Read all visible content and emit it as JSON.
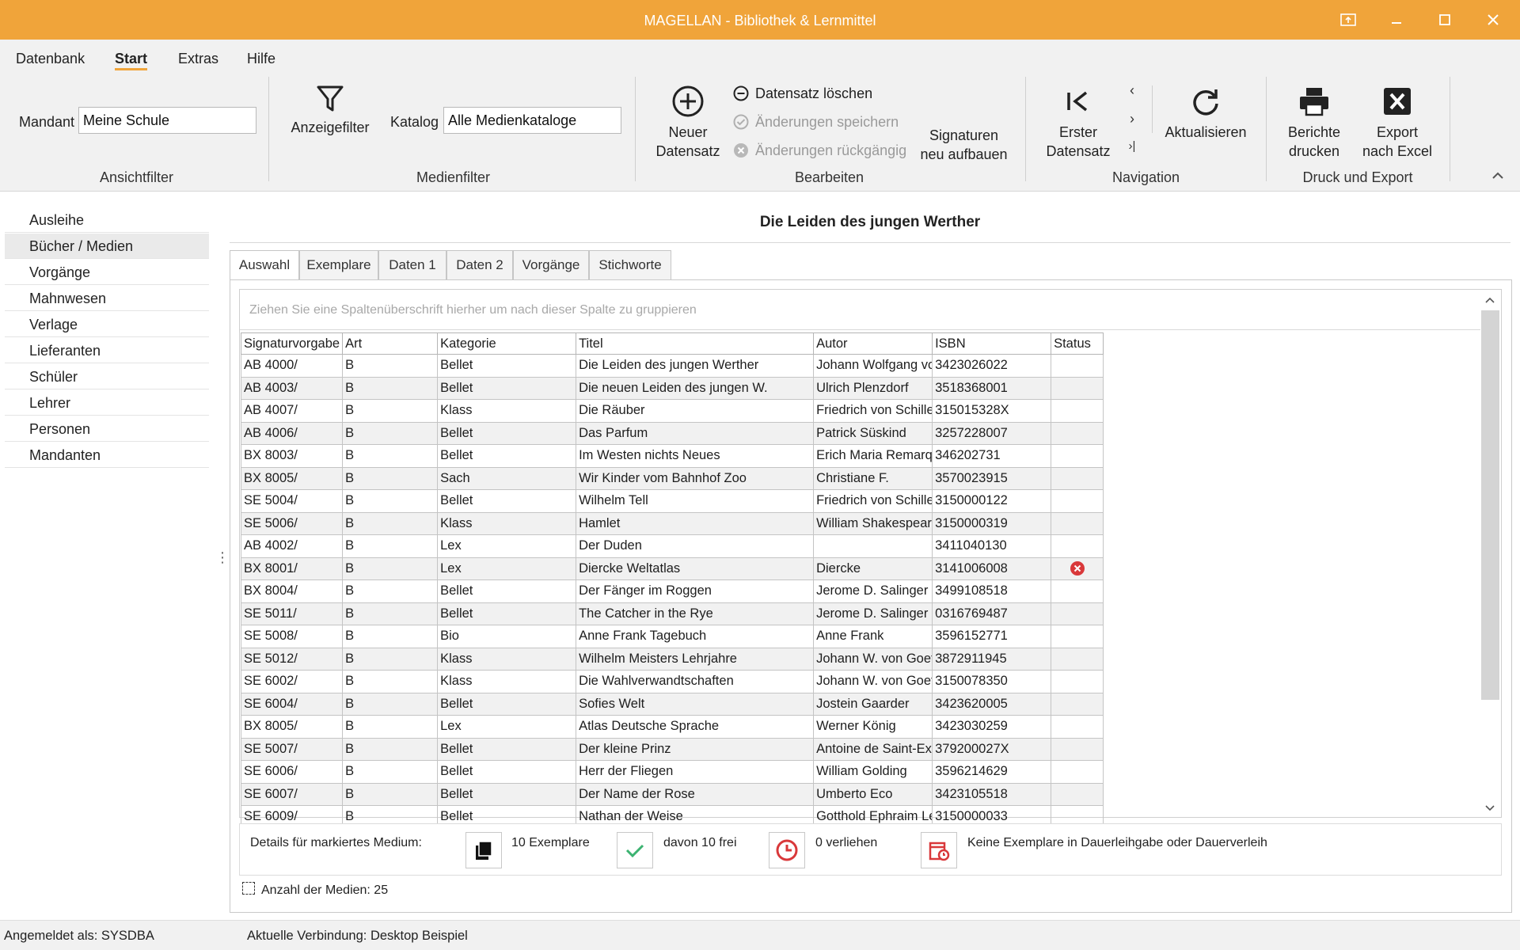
{
  "window": {
    "title": "MAGELLAN - Bibliothek & Lernmittel"
  },
  "menu": {
    "items": [
      "Datenbank",
      "Start",
      "Extras",
      "Hilfe"
    ],
    "active": "Start"
  },
  "ribbon": {
    "ansichtfilter": {
      "mandant_label": "Mandant",
      "mandant_value": "Meine Schule",
      "group": "Ansichtfilter"
    },
    "medienfilter": {
      "anzeigefilter": "Anzeigefilter",
      "katalog_label": "Katalog",
      "katalog_value": "Alle Medienkataloge",
      "group": "Medienfilter"
    },
    "bearbeiten": {
      "neuer_line1": "Neuer",
      "neuer_line2": "Datensatz",
      "loeschen": "Datensatz löschen",
      "speichern": "Änderungen speichern",
      "rueckgaengig": "Änderungen rückgängig",
      "signaturen_line1": "Signaturen",
      "signaturen_line2": "neu aufbauen",
      "group": "Bearbeiten"
    },
    "navigation": {
      "erster_line1": "Erster",
      "erster_line2": "Datensatz",
      "aktualisieren": "Aktualisieren",
      "group": "Navigation"
    },
    "druck": {
      "berichte_line1": "Berichte",
      "berichte_line2": "drucken",
      "export_line1": "Export",
      "export_line2": "nach Excel",
      "group": "Druck und Export"
    }
  },
  "sidebar": {
    "items": [
      {
        "label": "Ausleihe"
      },
      {
        "label": "Bücher / Medien"
      },
      {
        "label": "Vorgänge"
      },
      {
        "label": "Mahnwesen"
      },
      {
        "label": "Verlage"
      },
      {
        "label": "Lieferanten"
      },
      {
        "label": "Schüler"
      },
      {
        "label": "Lehrer"
      },
      {
        "label": "Personen"
      },
      {
        "label": "Mandanten"
      }
    ],
    "selected": "Bücher / Medien"
  },
  "main": {
    "heading": "Die Leiden des jungen Werther",
    "tabs": [
      "Auswahl",
      "Exemplare",
      "Daten 1",
      "Daten 2",
      "Vorgänge",
      "Stichworte"
    ],
    "active_tab": "Auswahl",
    "group_hint": "Ziehen Sie eine Spaltenüberschrift hierher um nach dieser Spalte zu gruppieren",
    "columns": [
      "Signaturvorgabe",
      "Art",
      "Kategorie",
      "Titel",
      "Autor",
      "ISBN",
      "Status"
    ],
    "rows": [
      [
        "AB 4000/",
        "B",
        "Bellet",
        "Die Leiden des jungen Werther",
        "Johann Wolfgang von Goethe",
        "3423026022",
        ""
      ],
      [
        "AB 4003/",
        "B",
        "Bellet",
        "Die neuen Leiden des jungen W.",
        "Ulrich Plenzdorf",
        "3518368001",
        ""
      ],
      [
        "AB 4007/",
        "B",
        "Klass",
        "Die Räuber",
        "Friedrich von Schiller",
        "315015328X",
        ""
      ],
      [
        "AB 4006/",
        "B",
        "Bellet",
        "Das Parfum",
        "Patrick Süskind",
        "3257228007",
        ""
      ],
      [
        "BX 8003/",
        "B",
        "Bellet",
        "Im Westen nichts Neues",
        "Erich Maria Remarque",
        "346202731",
        ""
      ],
      [
        "BX 8005/",
        "B",
        "Sach",
        "Wir Kinder vom Bahnhof Zoo",
        "Christiane F.",
        "3570023915",
        ""
      ],
      [
        "SE 5004/",
        "B",
        "Bellet",
        "Wilhelm Tell",
        "Friedrich von Schiller",
        "3150000122",
        ""
      ],
      [
        "SE 5006/",
        "B",
        "Klass",
        "Hamlet",
        "William Shakespeare",
        "3150000319",
        ""
      ],
      [
        "AB 4002/",
        "B",
        "Lex",
        "Der Duden",
        "",
        "3411040130",
        ""
      ],
      [
        "BX 8001/",
        "B",
        "Lex",
        "Diercke Weltatlas",
        "Diercke",
        "3141006008",
        "error"
      ],
      [
        "BX 8004/",
        "B",
        "Bellet",
        "Der Fänger im Roggen",
        "Jerome D. Salinger",
        "3499108518",
        ""
      ],
      [
        "SE 5011/",
        "B",
        "Bellet",
        "The Catcher in the Rye",
        "Jerome D. Salinger",
        "0316769487",
        ""
      ],
      [
        "SE 5008/",
        "B",
        "Bio",
        "Anne Frank Tagebuch",
        "Anne Frank",
        "3596152771",
        ""
      ],
      [
        "SE 5012/",
        "B",
        "Klass",
        "Wilhelm Meisters Lehrjahre",
        "Johann W. von Goethe",
        "3872911945",
        ""
      ],
      [
        "SE 6002/",
        "B",
        "Klass",
        "Die Wahlverwandtschaften",
        "Johann W. von Goethe",
        "3150078350",
        ""
      ],
      [
        "SE 6004/",
        "B",
        "Bellet",
        "Sofies Welt",
        "Jostein Gaarder",
        "3423620005",
        ""
      ],
      [
        "BX 8005/",
        "B",
        "Lex",
        "Atlas Deutsche Sprache",
        "Werner König",
        "3423030259",
        ""
      ],
      [
        "SE 5007/",
        "B",
        "Bellet",
        "Der kleine Prinz",
        "Antoine de Saint-Exupéry",
        "379200027X",
        ""
      ],
      [
        "SE 6006/",
        "B",
        "Bellet",
        "Herr der Fliegen",
        "William Golding",
        "3596214629",
        ""
      ],
      [
        "SE 6007/",
        "B",
        "Bellet",
        "Der Name der Rose",
        "Umberto Eco",
        "3423105518",
        ""
      ],
      [
        "SE 6009/",
        "B",
        "Bellet",
        "Nathan der Weise",
        "Gotthold Ephraim Lessing",
        "3150000033",
        ""
      ]
    ],
    "details": {
      "label": "Details für markiertes Medium:",
      "exemplare": "10 Exemplare",
      "frei": "davon 10 frei",
      "verliehen": "0 verliehen",
      "dauerleihgabe": "Keine Exemplare in Dauerleihgabe oder Dauerverleih"
    },
    "count": "Anzahl der Medien: 25"
  },
  "statusbar": {
    "user": "Angemeldet als: SYSDBA",
    "connection": "Aktuelle Verbindung: Desktop Beispiel"
  },
  "colors": {
    "accent": "#f0a43a",
    "error": "#d9383a",
    "check": "#3cb371"
  }
}
